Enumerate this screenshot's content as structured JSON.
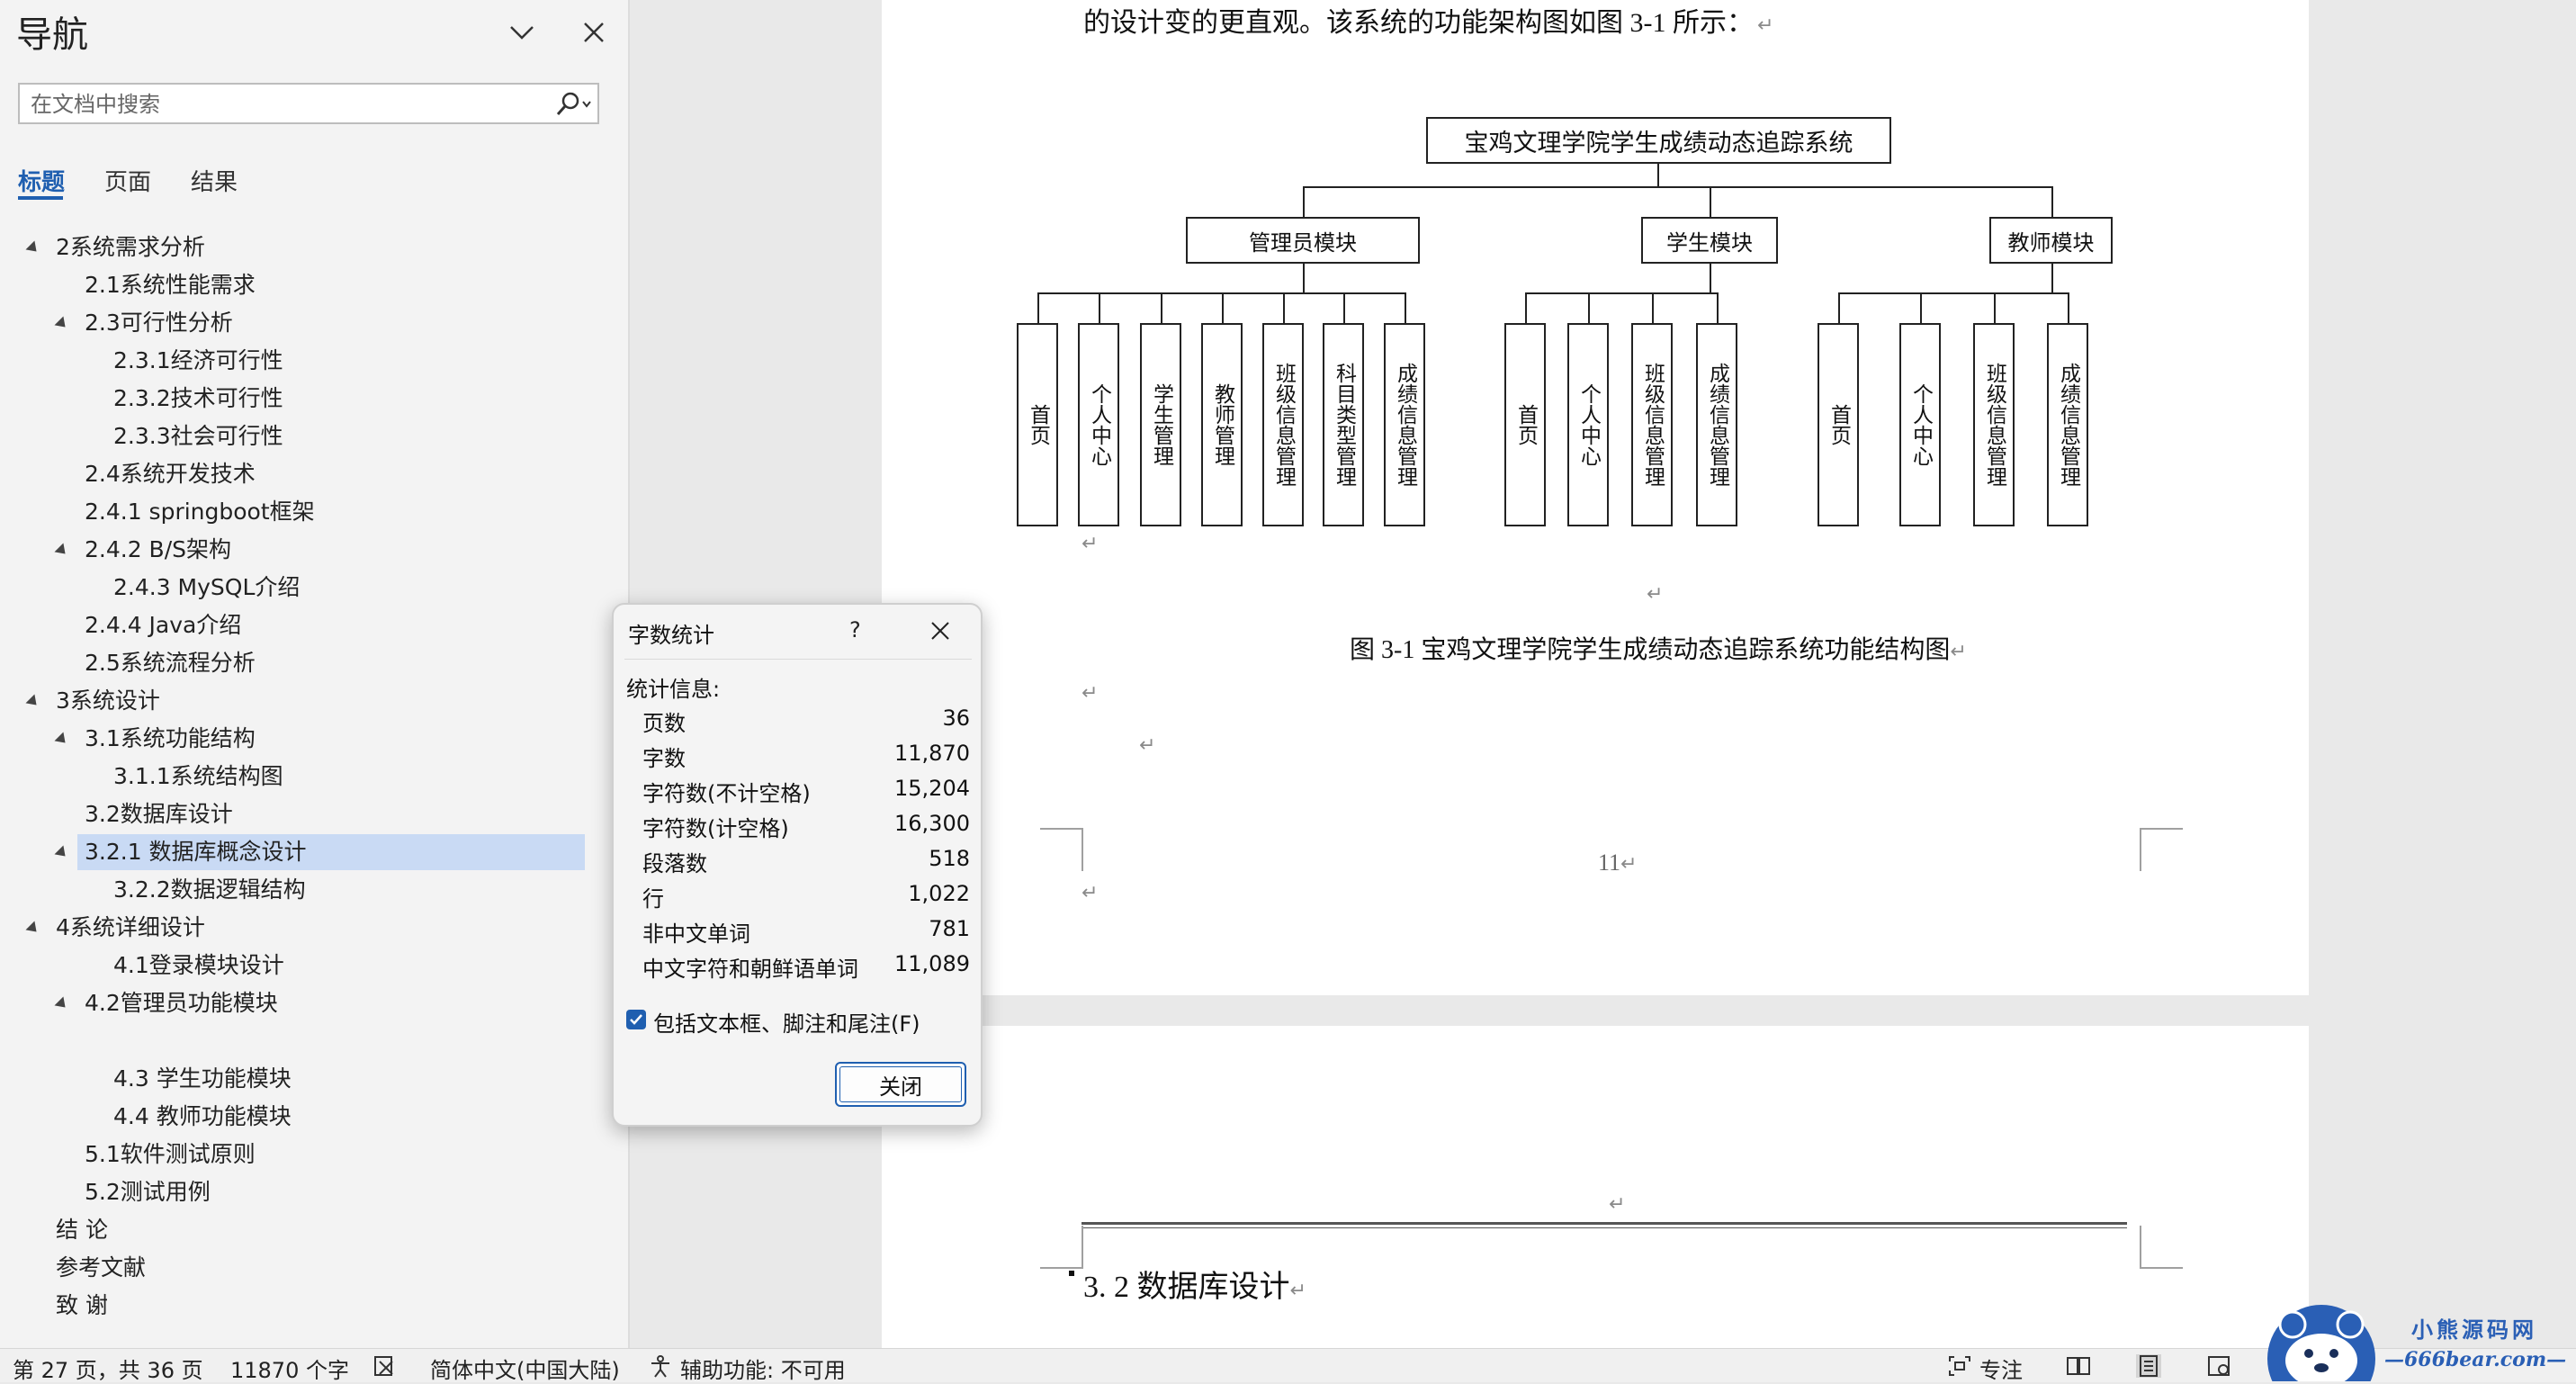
{
  "nav": {
    "title": "导航",
    "search_placeholder": "在文档中搜索",
    "tabs": [
      "标题",
      "页面",
      "结果"
    ],
    "headings": [
      {
        "text": "2系统需求分析",
        "level": 1,
        "expanded": true
      },
      {
        "text": "2.1系统性能需求",
        "level": 2
      },
      {
        "text": "2.3可行性分析",
        "level": 2,
        "expanded": true
      },
      {
        "text": "2.3.1经济可行性",
        "level": 3
      },
      {
        "text": "2.3.2技术可行性",
        "level": 3
      },
      {
        "text": "2.3.3社会可行性",
        "level": 3
      },
      {
        "text": "2.4系统开发技术",
        "level": 2
      },
      {
        "text": "2.4.1 springboot框架",
        "level": 2
      },
      {
        "text": "2.4.2 B/S架构",
        "level": 2,
        "expanded": true
      },
      {
        "text": "2.4.3 MySQL介绍",
        "level": 3
      },
      {
        "text": "2.4.4 Java介绍",
        "level": 2
      },
      {
        "text": "2.5系统流程分析",
        "level": 2
      },
      {
        "text": "3系统设计",
        "level": 1,
        "expanded": true
      },
      {
        "text": "3.1系统功能结构",
        "level": 2,
        "expanded": true
      },
      {
        "text": "3.1.1系统结构图",
        "level": 3
      },
      {
        "text": "3.2数据库设计",
        "level": 2
      },
      {
        "text": "3.2.1 数据库概念设计",
        "level": 2,
        "expanded": true,
        "selected": true
      },
      {
        "text": "3.2.2数据逻辑结构",
        "level": 3
      },
      {
        "text": "4系统详细设计",
        "level": 1,
        "expanded": true
      },
      {
        "text": "4.1登录模块设计",
        "level": 3
      },
      {
        "text": "4.2管理员功能模块",
        "level": 2,
        "expanded": true
      },
      {
        "text": "",
        "level": 3
      },
      {
        "text": "4.3 学生功能模块",
        "level": 3
      },
      {
        "text": "4.4 教师功能模块",
        "level": 3
      },
      {
        "text": "5.1软件测试原则",
        "level": 2
      },
      {
        "text": "5.2测试用例",
        "level": 2
      },
      {
        "text": "结  论",
        "level": 1
      },
      {
        "text": "参考文献",
        "level": 1
      },
      {
        "text": "致  谢",
        "level": 1
      }
    ]
  },
  "document": {
    "intro_line": "的设计变的更直观。该系统的功能架构图如图 3-1 所示：",
    "chart": {
      "root": "宝鸡文理学院学生成绩动态追踪系统",
      "modules": [
        {
          "name": "管理员模块",
          "children": [
            "首页",
            "个人中心",
            "学生管理",
            "教师管理",
            "班级信息管理",
            "科目类型管理",
            "成绩信息管理"
          ]
        },
        {
          "name": "学生模块",
          "children": [
            "首页",
            "个人中心",
            "班级信息管理",
            "成绩信息管理"
          ]
        },
        {
          "name": "教师模块",
          "children": [
            "首页",
            "个人中心",
            "班级信息管理",
            "成绩信息管理"
          ]
        }
      ]
    },
    "caption": "图 3-1  宝鸡文理学院学生成绩动态追踪系统功能结构图",
    "page_number": "11",
    "heading_next": "3. 2 数据库设计",
    "para_mark": "↵"
  },
  "dialog": {
    "title": "字数统计",
    "help": "?",
    "section": "统计信息:",
    "stats": [
      {
        "label": "页数",
        "value": "36"
      },
      {
        "label": "字数",
        "value": "11,870"
      },
      {
        "label": "字符数(不计空格)",
        "value": "15,204"
      },
      {
        "label": "字符数(计空格)",
        "value": "16,300"
      },
      {
        "label": "段落数",
        "value": "518"
      },
      {
        "label": "行",
        "value": "1,022"
      },
      {
        "label": "非中文单词",
        "value": "781"
      },
      {
        "label": "中文字符和朝鲜语单词",
        "value": "11,089"
      }
    ],
    "checkbox_label": "包括文本框、脚注和尾注(F)",
    "checkbox_checked": true,
    "close_button": "关闭"
  },
  "status": {
    "page": "第 27 页，共 36 页",
    "words": "11870 个字",
    "language": "简体中文(中国大陆)",
    "accessibility": "辅助功能: 不可用",
    "focus": "专注"
  },
  "watermark": {
    "brand": "小熊源码网",
    "url": "—666bear.com—"
  },
  "colors": {
    "accent": "#1f5fb0",
    "selected_heading": "#c9daf4",
    "nav_bg": "#f3f3f3",
    "workspace_bg": "#e9e9e9"
  }
}
